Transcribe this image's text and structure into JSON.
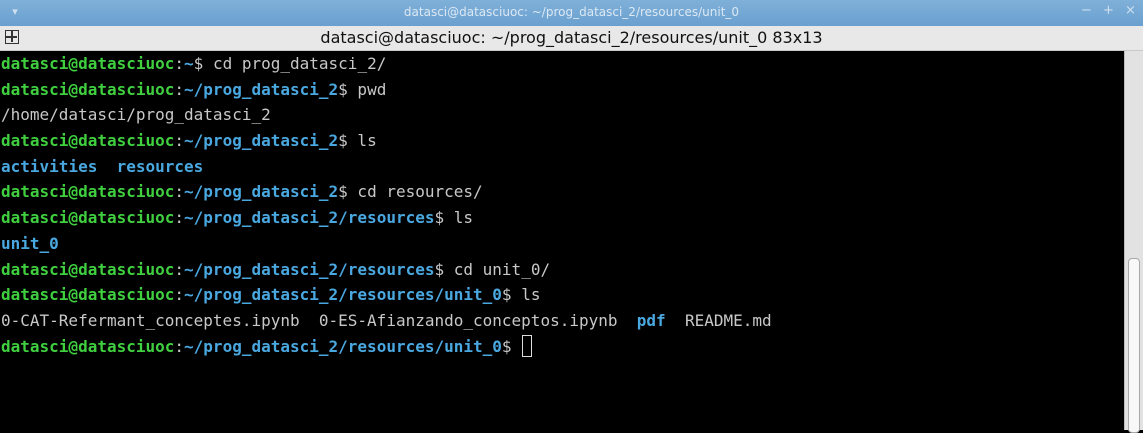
{
  "window": {
    "wm_title": "datasci@datasciuoc: ~/prog_datasci_2/resources/unit_0",
    "menu_icon": "chevron-down-icon",
    "controls": [
      "−",
      "+",
      "×"
    ]
  },
  "terminal": {
    "title": "datasci@datasciuoc: ~/prog_datasci_2/resources/unit_0 83x13",
    "user_host": "datasci@datasciuoc",
    "lines": [
      {
        "type": "prompt",
        "path": "~",
        "cmd": " cd prog_datasci_2/"
      },
      {
        "type": "prompt",
        "path": "~/prog_datasci_2",
        "cmd": " pwd"
      },
      {
        "type": "output",
        "text": "/home/datasci/prog_datasci_2"
      },
      {
        "type": "prompt",
        "path": "~/prog_datasci_2",
        "cmd": " ls"
      },
      {
        "type": "listing",
        "items": [
          {
            "text": "activities",
            "dir": true
          },
          {
            "text": "  ",
            "dir": false
          },
          {
            "text": "resources",
            "dir": true
          }
        ]
      },
      {
        "type": "prompt",
        "path": "~/prog_datasci_2",
        "cmd": " cd resources/"
      },
      {
        "type": "prompt",
        "path": "~/prog_datasci_2/resources",
        "cmd": " ls"
      },
      {
        "type": "listing",
        "items": [
          {
            "text": "unit_0",
            "dir": true
          }
        ]
      },
      {
        "type": "prompt",
        "path": "~/prog_datasci_2/resources",
        "cmd": " cd unit_0/"
      },
      {
        "type": "prompt",
        "path": "~/prog_datasci_2/resources/unit_0",
        "cmd": " ls"
      },
      {
        "type": "listing",
        "items": [
          {
            "text": "0-CAT-Refermant_conceptes.ipynb  0-ES-Afianzando_conceptos.ipynb  ",
            "dir": false
          },
          {
            "text": "pdf",
            "dir": true
          },
          {
            "text": "  README.md",
            "dir": false
          }
        ]
      },
      {
        "type": "prompt",
        "path": "~/prog_datasci_2/resources/unit_0",
        "cmd": " ",
        "cursor": true
      }
    ]
  }
}
